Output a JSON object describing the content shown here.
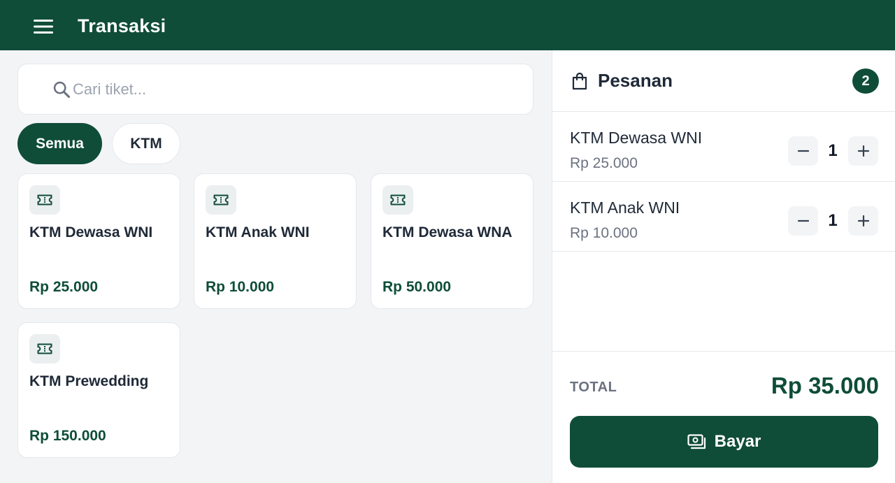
{
  "appbar": {
    "title": "Transaksi",
    "menu_icon": "menu-icon"
  },
  "search": {
    "placeholder": "Cari tiket...",
    "value": "",
    "icon": "search-icon"
  },
  "filters": [
    {
      "label": "Semua",
      "active": true
    },
    {
      "label": "KTM",
      "active": false
    }
  ],
  "tickets": [
    {
      "name": "KTM Dewasa WNI",
      "price": "Rp 25.000",
      "icon": "ticket-icon"
    },
    {
      "name": "KTM Anak WNI",
      "price": "Rp 10.000",
      "icon": "ticket-icon"
    },
    {
      "name": "KTM Dewasa WNA",
      "price": "Rp 50.000",
      "icon": "ticket-icon"
    },
    {
      "name": "KTM Prewedding",
      "price": "Rp 150.000",
      "icon": "ticket-icon"
    }
  ],
  "order": {
    "title": "Pesanan",
    "icon": "shopping-bag-icon",
    "count": "2",
    "items": [
      {
        "name": "KTM Dewasa WNI",
        "price": "Rp 25.000",
        "qty": "1"
      },
      {
        "name": "KTM Anak WNI",
        "price": "Rp 10.000",
        "qty": "1"
      }
    ],
    "total_label": "TOTAL",
    "total_value": "Rp 35.000",
    "pay_label": "Bayar",
    "pay_icon": "payments-icon"
  },
  "colors": {
    "primary": "#0f4d38",
    "background": "#f3f4f6",
    "surface": "#ffffff",
    "muted_text": "#6b7280"
  }
}
